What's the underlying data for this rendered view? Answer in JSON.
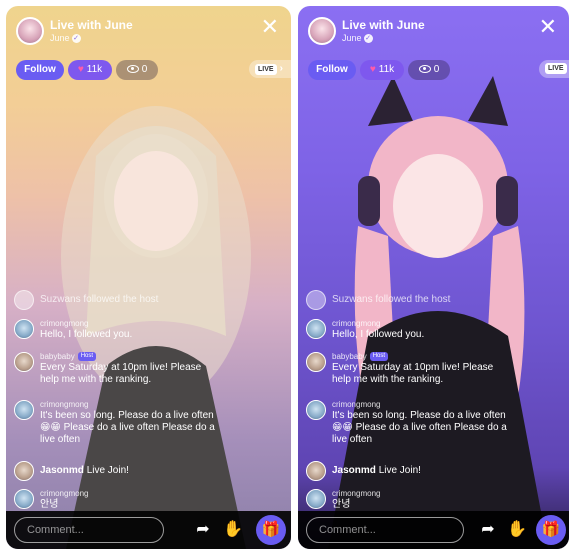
{
  "screens": [
    {
      "title": "Live with June",
      "host": "June",
      "follow_label": "Follow",
      "hearts_count": "11k",
      "viewers_count": "0",
      "live_badge": "LIVE",
      "chat": [
        {
          "type": "system",
          "text": "Suzwans followed the host"
        },
        {
          "type": "message",
          "name": "crimongmong",
          "text": "Hello, I followed you."
        },
        {
          "type": "message",
          "name": "babybaby",
          "host": true,
          "host_label": "Host",
          "text": "Every Saturday at 10pm live! Please help me with the ranking."
        },
        {
          "type": "message",
          "name": "crimongmong",
          "text": "It's been so long. Please do a live often 😁😁 Please do a live often Please do a live often"
        },
        {
          "type": "join",
          "name": "Jasonmd",
          "text": "Live Join!"
        },
        {
          "type": "message",
          "name": "crimongmong",
          "text": "안녕"
        }
      ],
      "comment_placeholder": "Comment...",
      "icons": {
        "share": "share-arrow-icon",
        "hand": "hand-wave-icon",
        "gift": "gift-icon",
        "close": "close-icon"
      }
    },
    {
      "title": "Live with June",
      "host": "June",
      "follow_label": "Follow",
      "hearts_count": "11k",
      "viewers_count": "0",
      "live_badge": "LIVE",
      "chat": [
        {
          "type": "system",
          "text": "Suzwans followed the host"
        },
        {
          "type": "message",
          "name": "crimongmong",
          "text": "Hello, I followed you."
        },
        {
          "type": "message",
          "name": "babybaby",
          "host": true,
          "host_label": "Host",
          "text": "Every Saturday at 10pm live! Please help me with the ranking."
        },
        {
          "type": "message",
          "name": "crimongmong",
          "text": "It's been so long. Please do a live often 😁😁 Please do a live often Please do a live often"
        },
        {
          "type": "join",
          "name": "Jasonmd",
          "text": "Live Join!"
        },
        {
          "type": "message",
          "name": "crimongmong",
          "text": "안녕"
        }
      ],
      "comment_placeholder": "Comment...",
      "icons": {
        "share": "share-arrow-icon",
        "hand": "hand-wave-icon",
        "gift": "gift-icon",
        "close": "close-icon"
      }
    }
  ]
}
